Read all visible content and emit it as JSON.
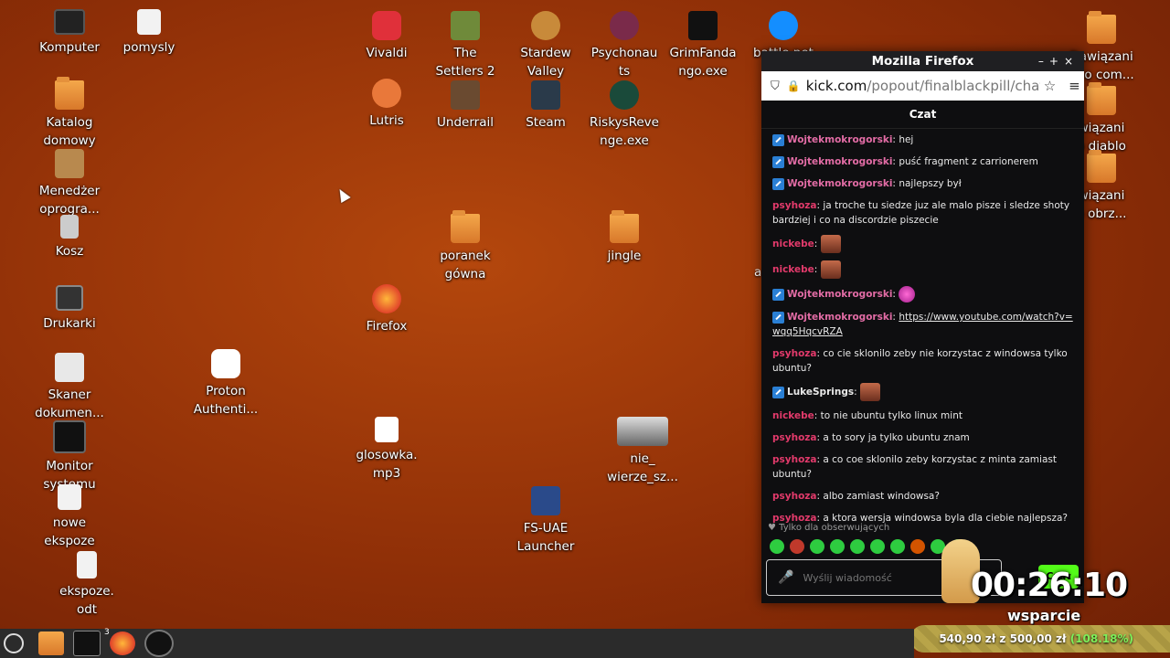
{
  "desktop_icons": {
    "komputer": "Komputer",
    "pomysly": "pomysly",
    "katalog": "Katalog\ndomowy",
    "menedzer": "Menedżer\noprogra...",
    "kosz": "Kosz",
    "drukarki": "Drukarki",
    "skaner": "Skaner\ndokumen...",
    "monitor": "Monitor\nsystemu",
    "nowe": "nowe\nekspoze",
    "ekspoze": "ekspoze.\nodt",
    "proton": "Proton\nAuthenti...",
    "vivaldi": "Vivaldi",
    "lutris": "Lutris",
    "firefox": "Firefox",
    "glosowka": "glosowka.\nmp3",
    "settlers": "The\nSettlers 2",
    "underrail": "Underrail",
    "poranek": "poranek\ngówna",
    "stardew": "Stardew\nValley",
    "steam": "Steam",
    "fsuae": "FS-UAE\nLauncher",
    "psychonauts": "Psychonau\nts",
    "riskys": "RiskysReve\nnge.exe",
    "jingle": "jingle",
    "nie_wierze": "nie_\nwierze_sz...",
    "grim": "GrimFanda\nngo.exe",
    "battlenet": "battle.net",
    "r1": "Dawiązani\nnuo com...",
    "r2": "wiązani\no diablo",
    "r3": "wiązani\no obrz...",
    "a_label": "a"
  },
  "firefox": {
    "window_title": "Mozilla Firefox",
    "url_host": "kick.com",
    "url_path": "/popout/finalblackpill/chat",
    "chat_header": "Czat",
    "messages": [
      {
        "user": "Wojtekmokrogorski",
        "text": "hej"
      },
      {
        "user": "Wojtekmokrogorski",
        "text": "puść fragment z carrionerem"
      },
      {
        "user": "Wojtekmokrogorski",
        "text": "najlepszy był"
      },
      {
        "user": "psyhoza",
        "text": "ja troche tu siedze juz ale malo pisze i sledze shoty bardziej i co na discordzie piszecie"
      },
      {
        "user": "nickebe",
        "text": ""
      },
      {
        "user": "nickebe",
        "text": ""
      },
      {
        "user": "Wojtekmokrogorski",
        "text": ""
      },
      {
        "user": "Wojtekmokrogorski",
        "link": "https://www.youtube.com/watch?v=wqq5HqcvRZA"
      },
      {
        "user": "psyhoza",
        "text": "co cie sklonilo zeby nie korzystac z windowsa tylko ubuntu?"
      },
      {
        "user": "LukeSprings",
        "text": ""
      },
      {
        "user": "nickebe",
        "text": "to nie ubuntu tylko linux mint"
      },
      {
        "user": "psyhoza",
        "text": "a to sory ja tylko ubuntu znam"
      },
      {
        "user": "psyhoza",
        "text": "a co coe sklonilo zeby korzystac z minta zamiast ubuntu?"
      },
      {
        "user": "psyhoza",
        "text": "albo zamiast windowsa?"
      },
      {
        "user": "psyhoza",
        "text": "a ktora wersja windowsa byla dla ciebie najlepsza?"
      }
    ],
    "followers_only": "Tylko dla obserwujących",
    "input_placeholder": "Wyślij wiadomość",
    "send_label": "Czat"
  },
  "overlay": {
    "timer": "00:26:10",
    "wsparcie": "wsparcie",
    "goal_text": "540,90 zł z 500,00 zł",
    "goal_pct": "(108.18%)"
  },
  "taskbar": {
    "firefox_badge": "3"
  }
}
